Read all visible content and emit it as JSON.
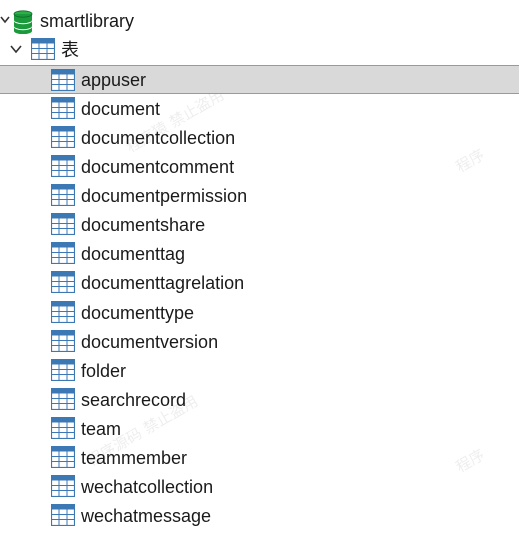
{
  "db": {
    "name": "smartlibrary",
    "icon": "database-icon",
    "color": "#1a9a3a"
  },
  "tables_group": {
    "label": "表",
    "icon": "table-folder-icon"
  },
  "tables": [
    "appuser",
    "document",
    "documentcollection",
    "documentcomment",
    "documentpermission",
    "documentshare",
    "documenttag",
    "documenttagrelation",
    "documenttype",
    "documentversion",
    "folder",
    "searchrecord",
    "team",
    "teammember",
    "wechatcollection",
    "wechatmessage"
  ],
  "selected_table": "appuser",
  "colors": {
    "table_icon": "#3c78b4",
    "selection": "#d9d9d9"
  }
}
